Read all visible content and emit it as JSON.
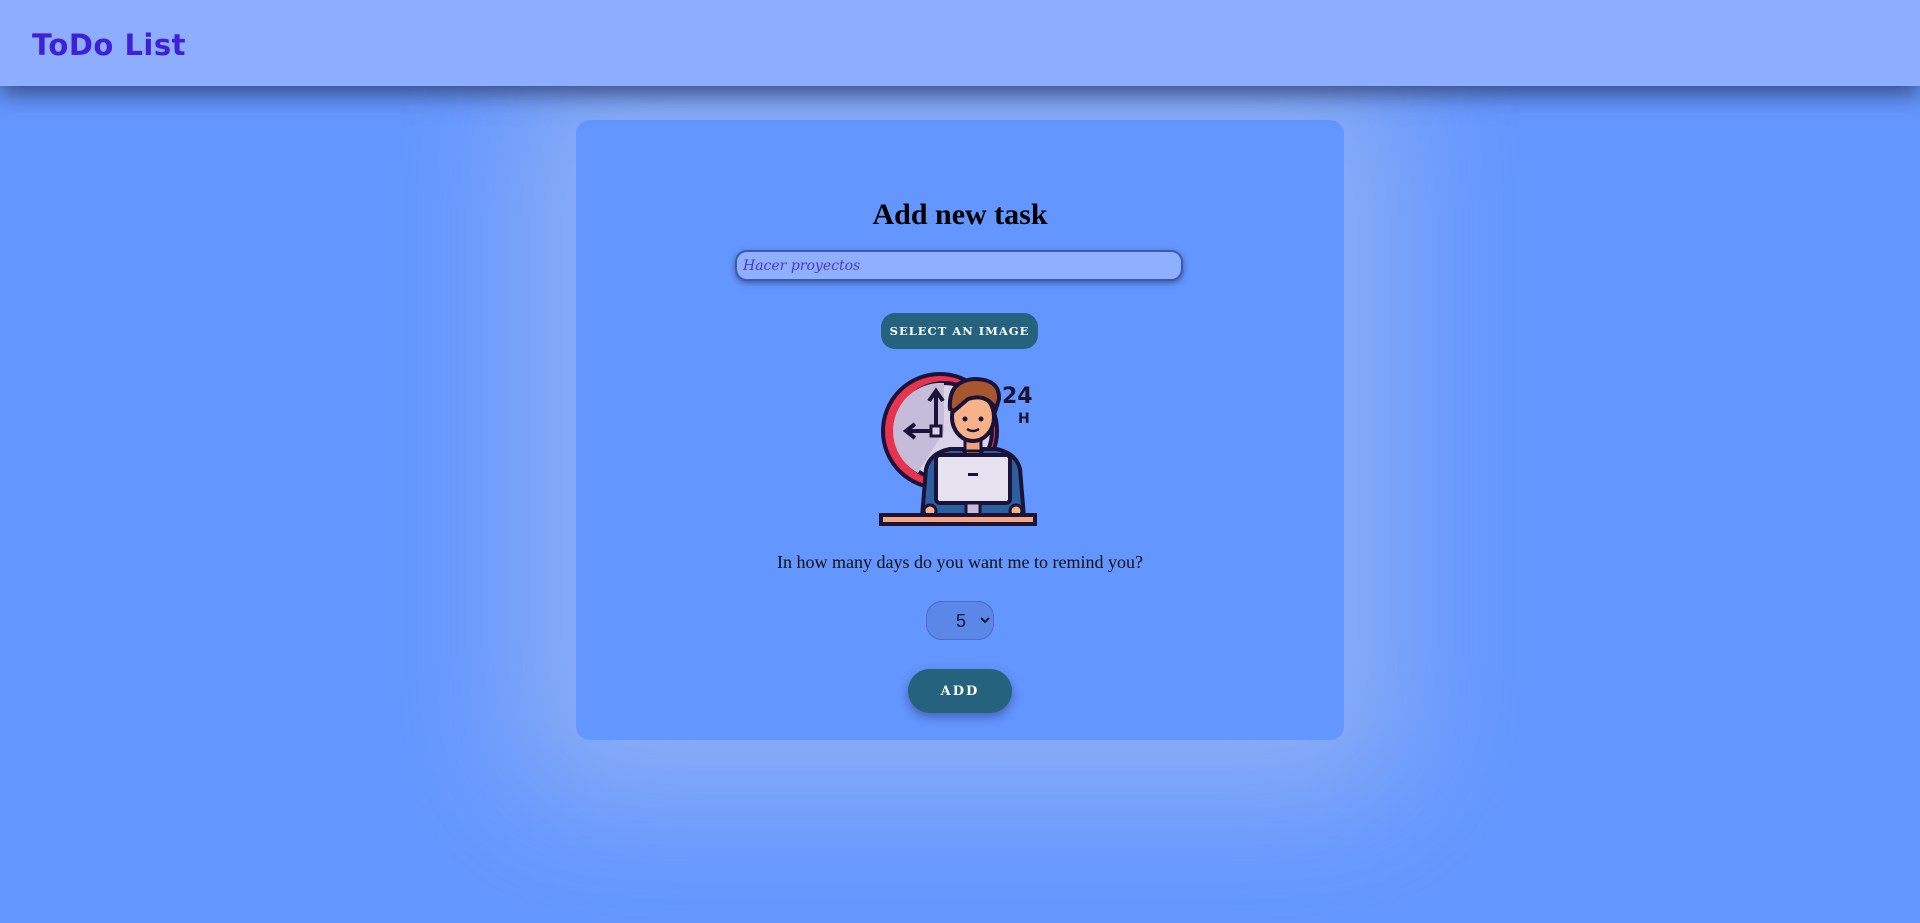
{
  "navbar": {
    "brand": "ToDo List"
  },
  "form": {
    "title": "Add new task",
    "task_input": {
      "placeholder": "Hacer proyectos",
      "value": ""
    },
    "select_image_label": "SELECT AN IMAGE",
    "image_icon": "person-at-computer-24h-clock-icon",
    "remind_label": "In how many days do you want me to remind you?",
    "days_select": {
      "selected": "5",
      "options": [
        "5"
      ]
    },
    "add_label": "ADD"
  },
  "colors": {
    "page_background": "#6497ff",
    "navbar_background": "#8dadff",
    "brand_text": "#3f1fd8",
    "button_background": "#24627e"
  }
}
